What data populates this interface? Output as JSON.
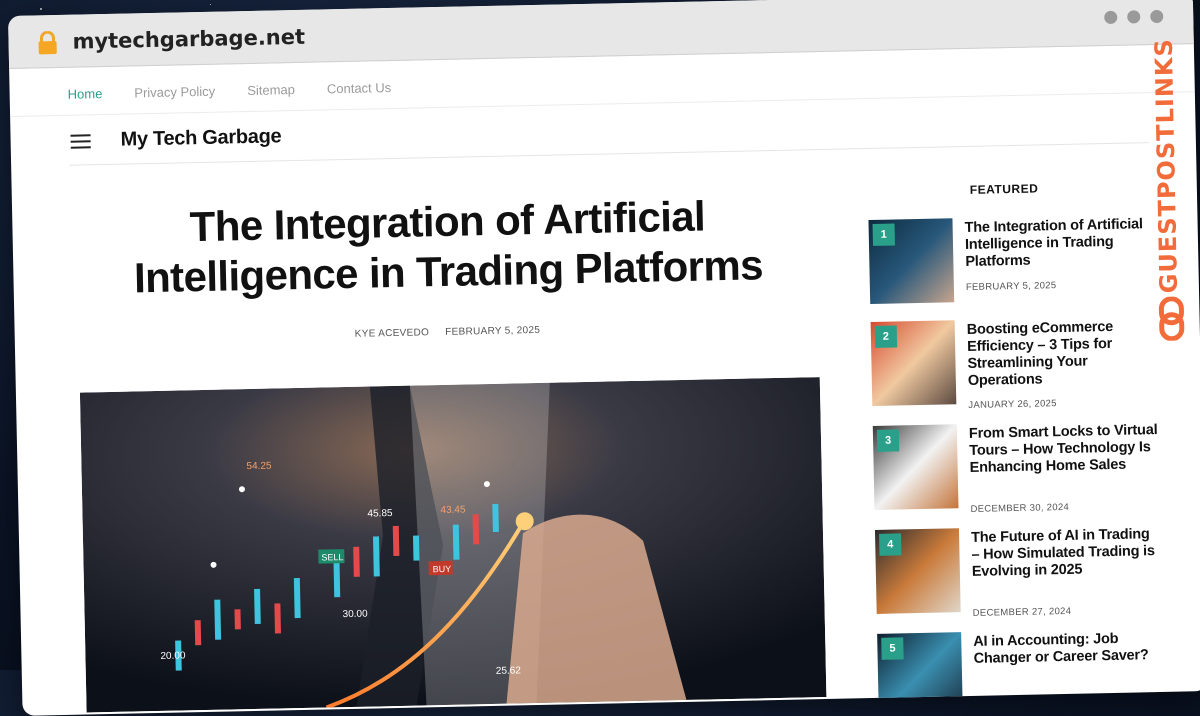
{
  "browser": {
    "url": "mytechgarbage.net",
    "icons": [
      "lock-icon",
      "window-dot-icon"
    ]
  },
  "topnav": {
    "items": [
      {
        "label": "Home"
      },
      {
        "label": "Privacy Policy"
      },
      {
        "label": "Sitemap"
      },
      {
        "label": "Contact Us"
      }
    ]
  },
  "site": {
    "name": "My Tech Garbage"
  },
  "article": {
    "title": "The Integration of Artificial Intelligence in Trading Platforms",
    "author": "KYE ACEVEDO",
    "date": "FEBRUARY 5, 2025",
    "hero_labels": {
      "price1": "54.25",
      "price2": "45.85",
      "price3": "43.45",
      "price4": "30.00",
      "price5": "20.00",
      "price6": "25.62",
      "sell": "SELL",
      "buy": "BUY"
    }
  },
  "sidebar": {
    "heading": "FEATURED",
    "items": [
      {
        "num": "1",
        "title": "The Integration of Artificial Intelligence in Trading Platforms",
        "date": "FEBRUARY 5, 2025"
      },
      {
        "num": "2",
        "title": "Boosting eCommerce Efficiency – 3 Tips for Streamlining Your Operations",
        "date": "JANUARY 26, 2025"
      },
      {
        "num": "3",
        "title": "From Smart Locks to Virtual Tours – How Technology Is Enhancing Home Sales",
        "date": "DECEMBER 30, 2024"
      },
      {
        "num": "4",
        "title": "The Future of AI in Trading – How Simulated Trading is Evolving in 2025",
        "date": "DECEMBER 27, 2024"
      },
      {
        "num": "5",
        "title": "AI in Accounting: Job Changer or Career Saver?",
        "date": ""
      }
    ]
  },
  "watermark": {
    "text": "GUESTPOSTLINKS"
  },
  "colors": {
    "accent": "#2aa08a",
    "watermark": "#f26b3a"
  }
}
